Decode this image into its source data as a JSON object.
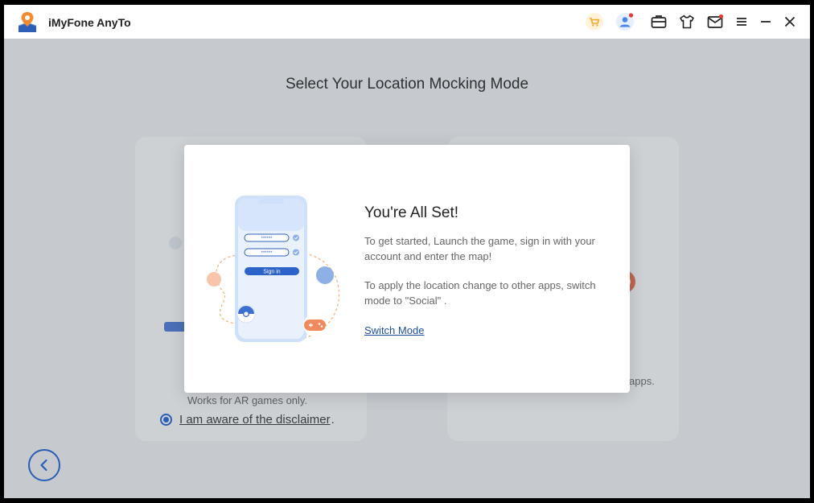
{
  "app": {
    "title": "iMyFone AnyTo"
  },
  "titlebar": {
    "icons": [
      "cart-icon",
      "user-account-icon",
      "toolbox-icon",
      "shirt-icon",
      "mail-icon",
      "menu-icon",
      "minimize-icon",
      "close-icon"
    ]
  },
  "main": {
    "page_title": "Select Your Location Mocking Mode",
    "left_card": {
      "description": "Works for AR games only.",
      "disclaimer": "I am aware of the disclaimer",
      "disclaimer_suffix": "."
    },
    "right_card": {
      "description_fragment": "apps."
    }
  },
  "dialog": {
    "title": "You're All Set!",
    "paragraph1": "To get started, Launch the game, sign in with your account and enter the map!",
    "paragraph2": "To apply the location change to other apps, switch mode to \"Social\" .",
    "link": "Switch Mode",
    "illustration": {
      "password_mask": "******",
      "sign_in_button": "Sign in"
    }
  },
  "colors": {
    "accent": "#1d5fd6",
    "link": "#1d4f9c",
    "cart": "#f5a623",
    "notification": "#e53935"
  }
}
